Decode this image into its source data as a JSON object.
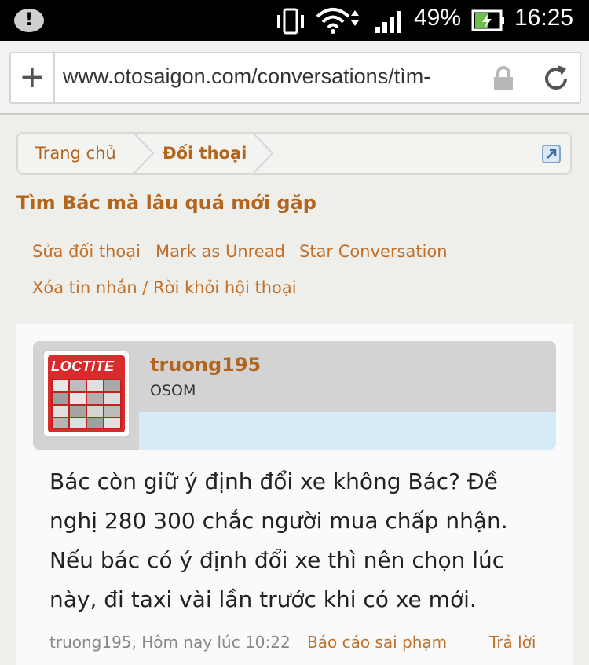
{
  "status_bar": {
    "battery_percent": "49%",
    "time": "16:25",
    "icons": [
      "warning-icon",
      "vibrate-icon",
      "wifi-icon",
      "signal-icon",
      "battery-charging-icon"
    ]
  },
  "browser": {
    "new_tab_label": "+",
    "url": "www.otosaigon.com/conversations/tìm-"
  },
  "breadcrumb": {
    "home": "Trang chủ",
    "current": "Đối thoại"
  },
  "page_title": "Tìm Bác mà lâu quá mới gặp",
  "actions": {
    "edit": "Sửa đối thoại",
    "mark_unread": "Mark as Unread",
    "star": "Star Conversation",
    "leave": "Xóa tin nhắn / Rời khỏi hội thoại"
  },
  "message": {
    "avatar_text": "LOCTITE",
    "username": "truong195",
    "user_title": "OSOM",
    "body": "Bác còn giữ ý định đổi xe không Bác? Đề nghị 280 300 chắc người mua chấp nhận. Nếu bác có ý định đổi xe thì nên chọn lúc này, đi taxi vài lần trước khi có xe mới.",
    "meta": "truong195, Hôm nay lúc 10:22",
    "report": "Báo cáo sai phạm",
    "reply": "Trả lời"
  },
  "colors": {
    "accent": "#b3651d",
    "link": "#c2702a",
    "status_bar_bg": "#000000"
  }
}
